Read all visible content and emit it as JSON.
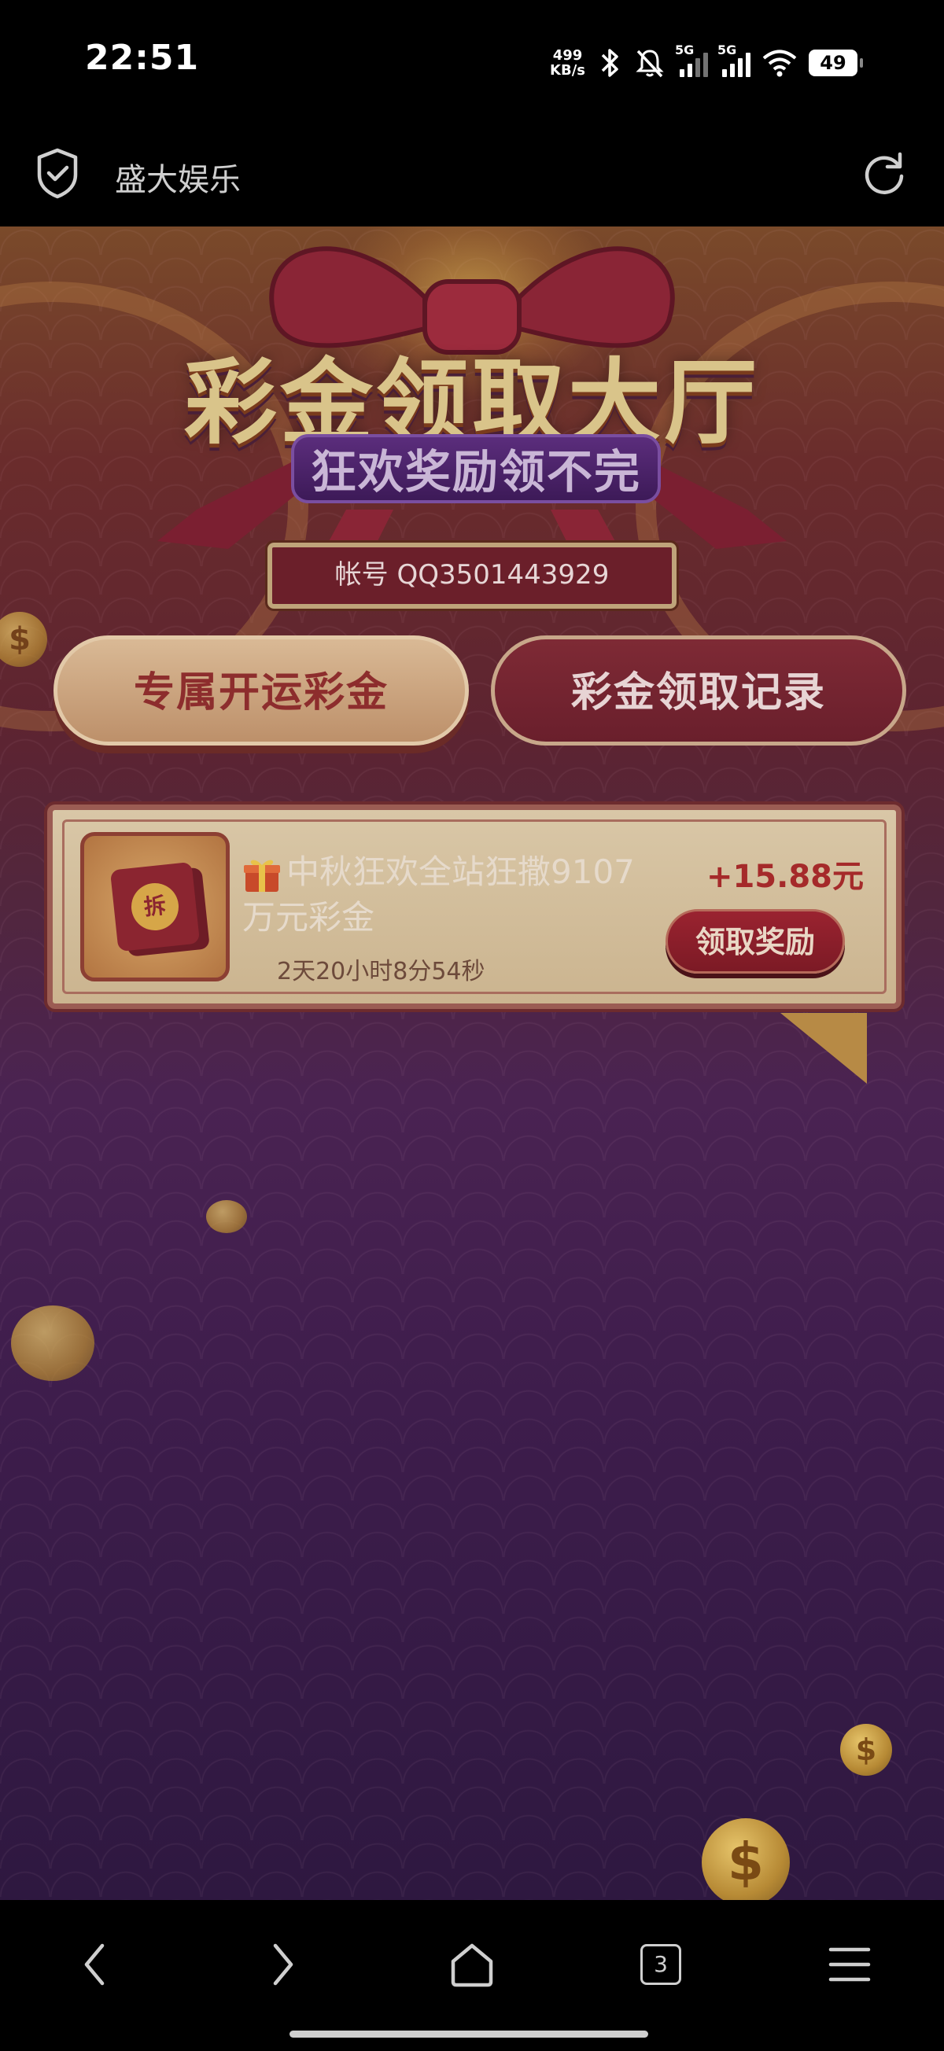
{
  "status_bar": {
    "time": "22:51",
    "net_speed_value": "499",
    "net_speed_unit": "KB/s",
    "sim1_label": "5G",
    "sim2_label": "5G",
    "battery": "49"
  },
  "browser": {
    "page_title": "盛大娱乐",
    "tab_count": "3"
  },
  "banner": {
    "title": "彩金领取大厅",
    "subtitle": "狂欢奖励领不完"
  },
  "account": {
    "label": "帐号 QQ3501443929"
  },
  "tabs": [
    {
      "label": "专属开运彩金"
    },
    {
      "label": "彩金领取记录"
    }
  ],
  "reward_card": {
    "icon_text": "拆",
    "title": "中秋狂欢全站狂撒9107万元彩金",
    "countdown": "2天20小时8分54秒",
    "amount": "+15.88元",
    "claim_label": "领取奖励"
  },
  "decor": {
    "coin_symbol": "$"
  },
  "colors": {
    "accent_red": "#a52a2a",
    "background_purple": "#3e1d4c",
    "gold": "#d9c48a"
  }
}
